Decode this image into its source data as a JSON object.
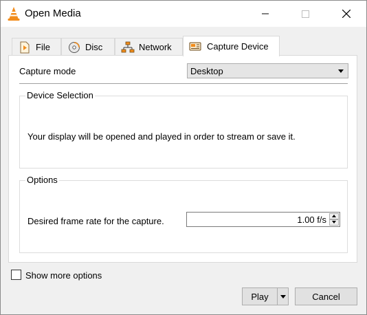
{
  "window": {
    "title": "Open Media",
    "controls": [
      "minimize",
      "maximize",
      "close"
    ]
  },
  "tabs": [
    {
      "label": "File",
      "icon": "file-icon",
      "active": false
    },
    {
      "label": "Disc",
      "icon": "disc-icon",
      "active": false
    },
    {
      "label": "Network",
      "icon": "network-icon",
      "active": false
    },
    {
      "label": "Capture Device",
      "icon": "capture-device-icon",
      "active": true
    }
  ],
  "capture": {
    "mode_label": "Capture mode",
    "mode_value": "Desktop"
  },
  "device_selection": {
    "title": "Device Selection",
    "message": "Your display will be opened and played in order to stream or save it."
  },
  "options": {
    "title": "Options",
    "frame_rate_label": "Desired frame rate for the capture.",
    "frame_rate_value": "1.00 f/s"
  },
  "show_more": {
    "label": "Show more options",
    "checked": false
  },
  "buttons": {
    "play": "Play",
    "cancel": "Cancel"
  },
  "colors": {
    "vlc_orange": "#f28c1b",
    "panel_bg": "#ffffff",
    "window_bg": "#f0f0f0"
  }
}
